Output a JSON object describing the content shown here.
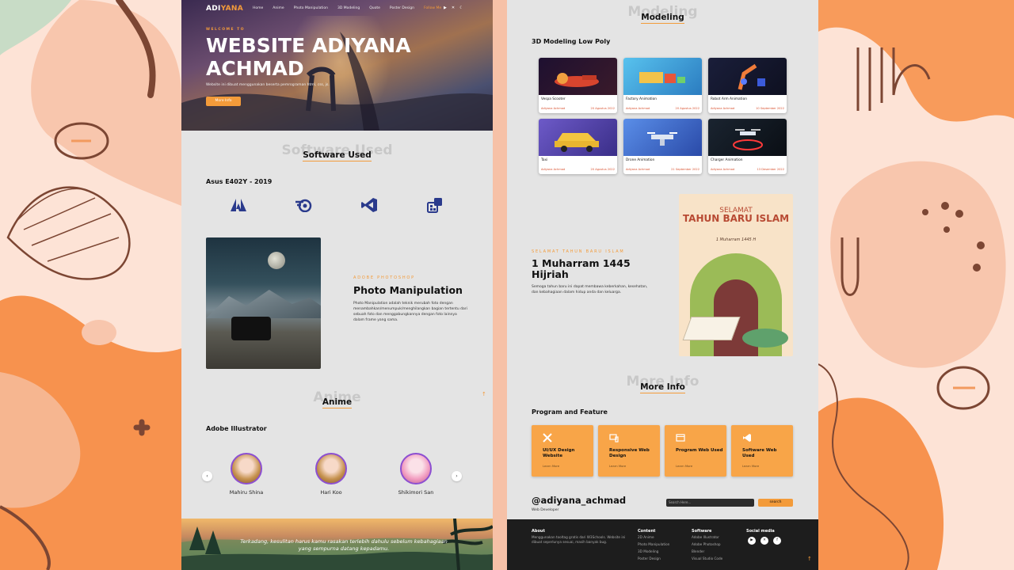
{
  "nav": {
    "logo_prefix": "ADI",
    "logo_suffix": "YANA",
    "links": [
      "Home",
      "Anime",
      "Photo Manipulation",
      "3D Modeling",
      "Quote",
      "Poster Design",
      "Follow Me"
    ],
    "active_index": 6
  },
  "hero": {
    "kicker": "WELCOME TO",
    "title": "WEBSITE ADIYANA ACHMAD",
    "description": "Website ini dibuat menggunakan beserta pemrograman html, css, js.",
    "button": "More Info"
  },
  "software": {
    "bg_title": "Software Used",
    "title": "Software Used",
    "device": "Asus E402Y - 2019",
    "icons": [
      "adobe-icon",
      "blender-icon",
      "vscode-icon",
      "figma-icon"
    ]
  },
  "photo_manipulation": {
    "kicker": "ADOBE PHOTOSHOP",
    "title": "Photo Manipulation",
    "text": "Photo Manipulation adalah teknik merubah foto dengan menambahkan/menumpuk/menghilangkan bagian tertentu dari sebuah foto dan menggabungkannya dengan foto lainnya dalam frame yang sama."
  },
  "anime": {
    "bg_title": "Anime",
    "title": "Anime",
    "subtitle": "Adobe Illustrator",
    "characters": [
      "Mahiru Shina",
      "Hari Koo",
      "Shikimori San"
    ]
  },
  "quote": {
    "text": "Terkadang, kesulitan harus kamu rasakan terlebih dahulu sebelum kebahagiaan yang sempurna datang kepadamu."
  },
  "modeling": {
    "bg_title": "Modeling",
    "title": "Modeling",
    "subtitle": "3D Modeling Low Poly",
    "cards": [
      {
        "title": "Vespa Scooter",
        "meta": "Adiyana Achmad",
        "date": "20 Agustus 2022"
      },
      {
        "title": "Factory Animation",
        "meta": "Adiyana Achmad",
        "date": "20 Agustus 2022"
      },
      {
        "title": "Robot Arm Animation",
        "meta": "Adiyana Achmad",
        "date": "10 September 2022"
      },
      {
        "title": "Taxi",
        "meta": "Adiyana Achmad",
        "date": "20 Agustus 2022"
      },
      {
        "title": "Drone Animation",
        "meta": "Adiyana Achmad",
        "date": "21 September 2022"
      },
      {
        "title": "Charger Animation",
        "meta": "Adiyana Achmad",
        "date": "13 Desember 2022"
      }
    ]
  },
  "islamic": {
    "kicker": "SELAMAT TAHUN BARU ISLAM",
    "title": "1 Muharram 1445 Hijriah",
    "text": "Semoga tahun baru ini dapat membawa keberkahan, kesehatan, dan kebahagiaan dalam hidup anda dan keluarga.",
    "poster_line1": "SELAMAT",
    "poster_line2": "TAHUN BARU ISLAM",
    "poster_line3": "1 Muharram 1445 H"
  },
  "more_info": {
    "bg_title": "More Info",
    "title": "More Info",
    "subtitle": "Program and Feature",
    "cards": [
      {
        "title": "UI/UX Design Website",
        "link": "Learn More"
      },
      {
        "title": "Responsive Web Design",
        "link": "Learn More"
      },
      {
        "title": "Program Web Used",
        "link": "Learn More"
      },
      {
        "title": "Software Web Used",
        "link": "Learn More"
      }
    ]
  },
  "profile": {
    "handle": "@adiyana_achmad",
    "role": "Web Developer",
    "search_placeholder": "Search Here...",
    "search_button": "search"
  },
  "footer": {
    "about_title": "About",
    "about_text": "Menggunakan tooltag gratis dari W3Schools. Website ini dibuat seperlunya sesuai, masih banyak bug.",
    "content_title": "Content",
    "content_items": [
      "2D Anime",
      "Photo Manipulation",
      "3D Modeling",
      "Poster Design"
    ],
    "software_title": "Software",
    "software_items": [
      "Adobe Illustrator",
      "Adobe Photoshop",
      "Blender",
      "Visual Studio Code"
    ],
    "social_title": "Social media"
  },
  "colors": {
    "accent": "#f39b3a",
    "card": "#f8a548",
    "footer": "#1d1d1d",
    "page": "#e4e4e4"
  }
}
